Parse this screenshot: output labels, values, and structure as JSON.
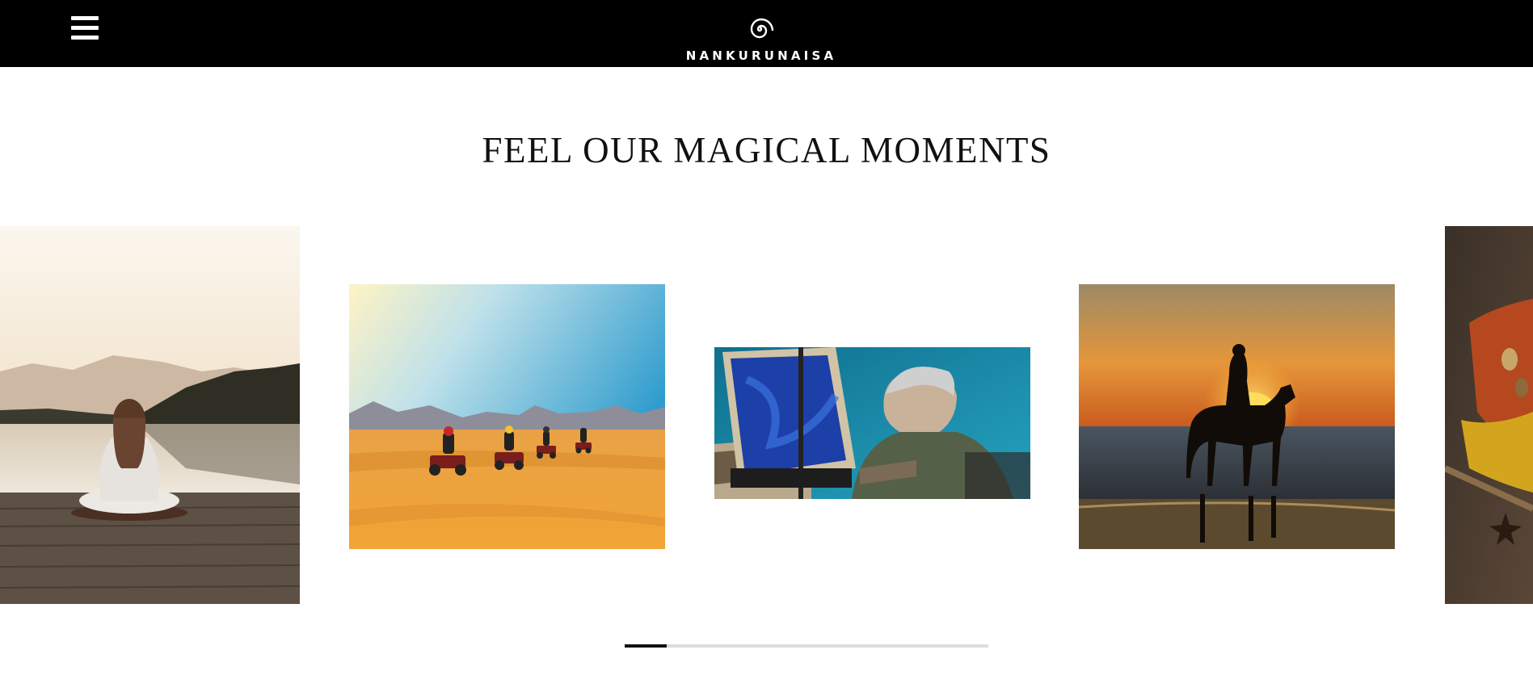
{
  "header": {
    "menu_icon": "hamburger-menu-icon",
    "logo_icon": "spiral-logo-icon",
    "brand": "NANKURUNAISA",
    "background": "#000000"
  },
  "main": {
    "heading": "FEEL OUR MAGICAL MOMENTS"
  },
  "carousel": {
    "slides": [
      {
        "subject": "meditation-on-lake-dock"
      },
      {
        "subject": "quad-bikes-in-desert"
      },
      {
        "subject": "painter-at-easel-by-sea"
      },
      {
        "subject": "horse-rider-silhouette-at-sunset"
      },
      {
        "subject": "spices-on-wood"
      }
    ],
    "progress": 0.115,
    "progress_color": "#111111",
    "track_color": "#dcdcdc"
  }
}
